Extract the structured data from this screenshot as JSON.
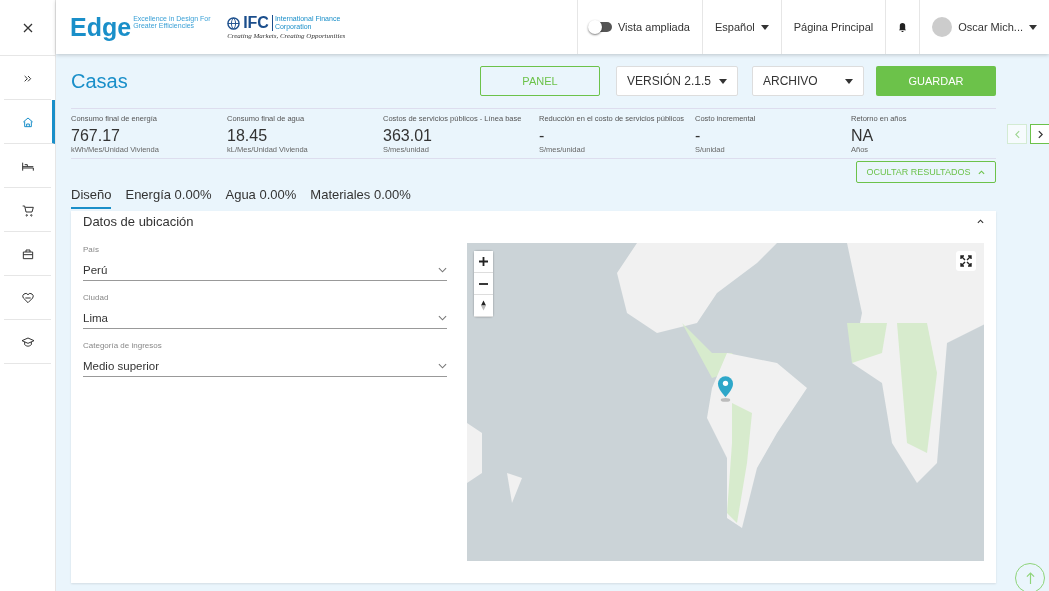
{
  "logo": {
    "brand": "Edge",
    "tagline": "Excellence in Design For Greater Efficiencies",
    "org": "IFC",
    "org_name": "International Finance Corporation",
    "motto": "Creating Markets, Creating Opportunities"
  },
  "top_bar": {
    "toggle": {
      "label": "Vista ampliada",
      "on": false
    },
    "language": "Español",
    "home_link": "Página Principal",
    "user": "Oscar Mich..."
  },
  "sidebar": {
    "items": [
      {
        "selected": false
      },
      {
        "selected": true
      },
      {
        "selected": false
      },
      {
        "selected": false
      },
      {
        "selected": false
      },
      {
        "selected": false
      },
      {
        "selected": false
      }
    ]
  },
  "page": {
    "title": "Casas",
    "panel_button": "PANEL",
    "version": "VERSIÓN 2.1.5",
    "file_menu": "ARCHIVO",
    "save_button": "GUARDAR"
  },
  "metrics": [
    {
      "label": "Consumo final de energía",
      "value": "767.17",
      "unit": "kWh/Mes/Unidad Vivienda"
    },
    {
      "label": "Consumo final de agua",
      "value": "18.45",
      "unit": "kL/Mes/Unidad Vivienda"
    },
    {
      "label": "Costos de servicios públicos - Línea base",
      "value": "363.01",
      "unit": "S/mes/unidad"
    },
    {
      "label": "Reducción en el costo de servicios públicos",
      "value": "-",
      "unit": "S/mes/unidad"
    },
    {
      "label": "Costo incremental",
      "value": "-",
      "unit": "S/unidad"
    },
    {
      "label": "Retorno en años",
      "value": "NA",
      "unit": "Años"
    }
  ],
  "metric_nav": {
    "prev_disabled": true,
    "next_disabled": false
  },
  "hide_results_button": "OCULTAR RESULTADOS",
  "tabs": [
    {
      "label": "Diseño",
      "selected": true
    },
    {
      "label": "Energía 0.00%",
      "selected": false
    },
    {
      "label": "Agua 0.00%",
      "selected": false
    },
    {
      "label": "Materiales 0.00%",
      "selected": false
    }
  ],
  "location_card": {
    "title": "Datos de ubicación",
    "expanded": true,
    "fields": [
      {
        "label": "País",
        "value": "Perú"
      },
      {
        "label": "Ciudad",
        "value": "Lima"
      },
      {
        "label": "Categoría de ingresos",
        "value": "Medio superior"
      }
    ]
  }
}
